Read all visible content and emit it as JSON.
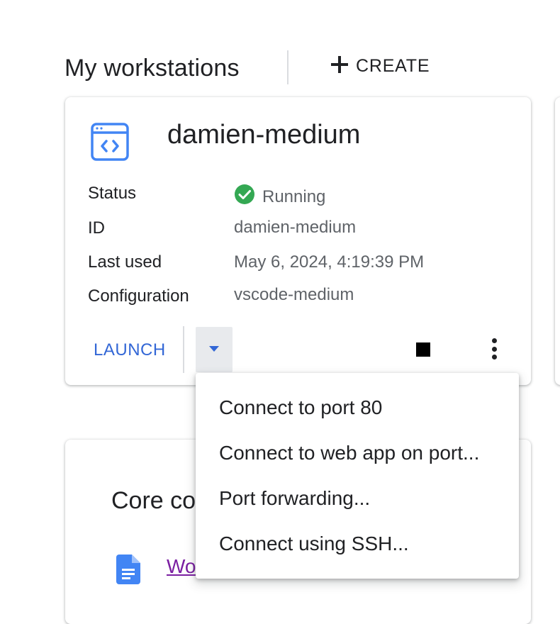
{
  "header": {
    "title": "My workstations",
    "create_label": "CREATE",
    "create_icon": "plus-icon"
  },
  "workstation": {
    "name": "damien-medium",
    "icon": "code-window-icon",
    "details": {
      "status_label": "Status",
      "status_value": "Running",
      "status_icon": "check-circle-icon",
      "status_color": "#34a853",
      "id_label": "ID",
      "id_value": "damien-medium",
      "last_used_label": "Last used",
      "last_used_value": "May 6, 2024, 4:19:39 PM",
      "config_label": "Configuration",
      "config_value": "vscode-medium"
    },
    "actions": {
      "launch_label": "LAUNCH",
      "dropdown_icon": "caret-down-icon",
      "stop_icon": "stop-icon",
      "more_icon": "more-vert-icon"
    }
  },
  "dropdown_menu": {
    "items": [
      "Connect to port 80",
      "Connect to web app on port...",
      "Port forwarding...",
      "Connect using SSH..."
    ]
  },
  "core": {
    "title": "Core co",
    "link_text": "Wo",
    "doc_icon": "document-icon"
  },
  "colors": {
    "accent": "#3367d6",
    "icon_blue": "#4285f4",
    "link_visited": "#7b1fa2"
  }
}
